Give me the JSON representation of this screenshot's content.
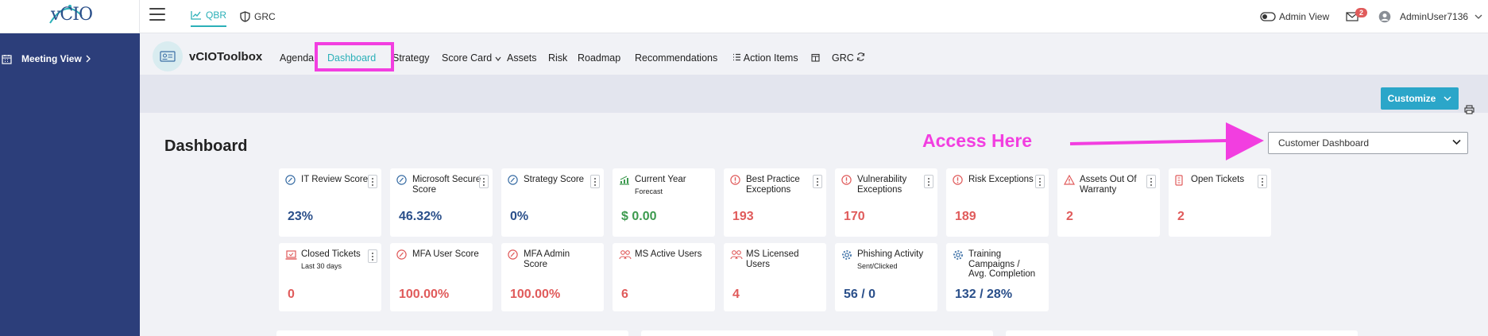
{
  "topbar": {
    "logo_text": "vCIO",
    "tabs": [
      {
        "label": "QBR"
      },
      {
        "label": "GRC"
      }
    ],
    "admin_view": "Admin View",
    "mail_badge": "2",
    "user": "AdminUser7136"
  },
  "sidebar": {
    "meeting_view": "Meeting View"
  },
  "subnav": {
    "brand": "vCIOToolbox",
    "items": [
      "Agenda",
      "Dashboard",
      "Strategy",
      "Score Card",
      "Assets",
      "Risk",
      "Roadmap",
      "Recommendations",
      "Action Items",
      "GRC"
    ]
  },
  "toolbar": {
    "customize": "Customize"
  },
  "main": {
    "title": "Dashboard",
    "annotation": "Access Here",
    "dashboard_select": "Customer Dashboard"
  },
  "colors": {
    "accent": "#2bb0b8",
    "sidebar": "#2c3e7a",
    "highlight": "#f23ee0",
    "value_blue": "#2a4f8a",
    "value_red": "#e05b5b",
    "value_green": "#3c9a4e"
  },
  "cards": [
    {
      "title": "IT Review Score",
      "sub": "",
      "value": "23%",
      "color": "#2a4f8a",
      "icon": "gauge-icon",
      "kebab": true
    },
    {
      "title": "Microsoft Secure Score",
      "sub": "",
      "value": "46.32%",
      "color": "#2a4f8a",
      "icon": "gauge-icon",
      "kebab": true
    },
    {
      "title": "Strategy Score",
      "sub": "",
      "value": "0%",
      "color": "#2a4f8a",
      "icon": "gauge-icon",
      "kebab": true
    },
    {
      "title": "Current Year",
      "sub": "Forecast",
      "value": "$ 0.00",
      "color": "#3c9a4e",
      "icon": "chart-icon",
      "kebab": false
    },
    {
      "title": "Best Practice Exceptions",
      "sub": "",
      "value": "193",
      "color": "#e05b5b",
      "icon": "alert-circle-icon",
      "kebab": true
    },
    {
      "title": "Vulnerability Exceptions",
      "sub": "",
      "value": "170",
      "color": "#e05b5b",
      "icon": "alert-circle-icon",
      "kebab": true
    },
    {
      "title": "Risk Exceptions",
      "sub": "",
      "value": "189",
      "color": "#e05b5b",
      "icon": "alert-circle-icon",
      "kebab": true
    },
    {
      "title": "Assets Out Of Warranty",
      "sub": "",
      "value": "2",
      "color": "#e05b5b",
      "icon": "warning-triangle-icon",
      "kebab": true
    },
    {
      "title": "Open Tickets",
      "sub": "",
      "value": "2",
      "color": "#e05b5b",
      "icon": "ticket-icon",
      "kebab": true
    },
    {
      "title": "Closed Tickets",
      "sub": "Last 30 days",
      "value": "0",
      "color": "#e05b5b",
      "icon": "laptop-icon",
      "kebab": true
    },
    {
      "title": "MFA User Score",
      "sub": "",
      "value": "100.00%",
      "color": "#e05b5b",
      "icon": "gauge-icon",
      "kebab": false
    },
    {
      "title": "MFA Admin Score",
      "sub": "",
      "value": "100.00%",
      "color": "#e05b5b",
      "icon": "gauge-icon",
      "kebab": false
    },
    {
      "title": "MS Active Users",
      "sub": "",
      "value": "6",
      "color": "#e05b5b",
      "icon": "users-icon",
      "kebab": false
    },
    {
      "title": "MS Licensed Users",
      "sub": "",
      "value": "4",
      "color": "#e05b5b",
      "icon": "users-icon",
      "kebab": false
    },
    {
      "title": "Phishing Activity",
      "sub": "Sent/Clicked",
      "value": "56 / 0",
      "color": "#2a4f8a",
      "icon": "gear-icon",
      "kebab": false
    },
    {
      "title": "Training Campaigns / Avg. Completion",
      "sub": "",
      "value": "132 / 28%",
      "color": "#2a4f8a",
      "icon": "gear-icon",
      "kebab": false
    }
  ]
}
